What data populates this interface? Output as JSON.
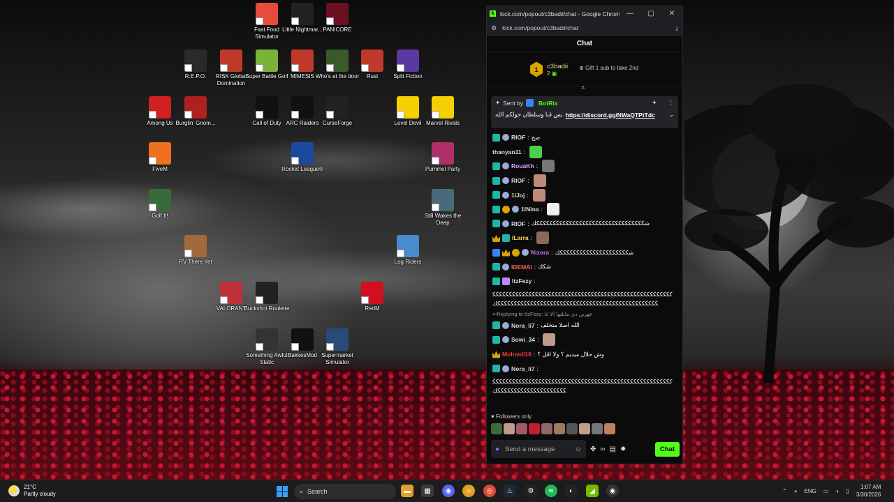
{
  "desktop_icons": [
    {
      "label": "Fast Food Simulator",
      "color": "#e64b3c"
    },
    {
      "label": "Little Nightmar...",
      "color": "#222"
    },
    {
      "label": "PANICORE",
      "color": "#6b1020"
    },
    {
      "label": "R.E.P.O.",
      "color": "#2a2a2a"
    },
    {
      "label": "RISK Global Domination",
      "color": "#c0392b"
    },
    {
      "label": "Super Battle Golf",
      "color": "#7bb33a"
    },
    {
      "label": "MIMESIS",
      "color": "#c0392b"
    },
    {
      "label": "Who's at the door",
      "color": "#3a5a2a"
    },
    {
      "label": "Rust",
      "color": "#c0392b"
    },
    {
      "label": "Split Fiction",
      "color": "#5a3aa0"
    },
    {
      "label": "Among Us",
      "color": "#d21f1f"
    },
    {
      "label": "Burglin' Gnom...",
      "color": "#b02020"
    },
    {
      "label": "Call of Duty",
      "color": "#111"
    },
    {
      "label": "ARC Raiders",
      "color": "#111"
    },
    {
      "label": "CurseForge",
      "color": "#222"
    },
    {
      "label": "Level Devil",
      "color": "#f5d000"
    },
    {
      "label": "Marvel Rivals",
      "color": "#f5d000"
    },
    {
      "label": "FiveM",
      "color": "#f07020"
    },
    {
      "label": "Rocket League®",
      "color": "#1a4aa0"
    },
    {
      "label": "Pummel Party",
      "color": "#b0306a"
    },
    {
      "label": "Golf It!",
      "color": "#3a6a3a"
    },
    {
      "label": "Still Wakes the Deep",
      "color": "#4a6a7a"
    },
    {
      "label": "RV There Yet",
      "color": "#a06a3a"
    },
    {
      "label": "Log Riders",
      "color": "#4a8ad0"
    },
    {
      "label": "VALORANT",
      "color": "#c0303a"
    },
    {
      "label": "Buckshot Roulette",
      "color": "#222"
    },
    {
      "label": "RedM",
      "color": "#d01020"
    },
    {
      "label": "Something Awful Static",
      "color": "#333"
    },
    {
      "label": "BakkesMod",
      "color": "#111"
    },
    {
      "label": "Supermarket Simulator",
      "color": "#2a4a7a"
    }
  ],
  "window": {
    "title": "kick.com/popout/c3badii/chat - Google Chrome",
    "url": "kick.com/popout/c3badii/chat",
    "chat_header": "Chat"
  },
  "pinned": {
    "rank": "1",
    "user": "c3badii",
    "count": "2",
    "gift_text": "Gift 1 sub to take 2nd"
  },
  "bot_message": {
    "sent_by": "Sent by",
    "bot_name": "BotRix",
    "text": "بس قنا وسلطان حولكم الله",
    "link": "https://discord.gg/NWaQTPtTdc"
  },
  "messages": [
    {
      "name": "RIOF",
      "color": "#ddd",
      "text": "صح",
      "badges": [
        "sub",
        "moji"
      ]
    },
    {
      "name": "thanyan11",
      "color": "#ddd",
      "text": "",
      "emote": "#4ad04a",
      "badges": []
    },
    {
      "name": "RouaKh",
      "color": "#d8a0ff",
      "text": "",
      "emote": "#777",
      "badges": [
        "sub",
        "moji"
      ]
    },
    {
      "name": "RIOF",
      "color": "#ddd",
      "text": "",
      "emote": "#c08a7a",
      "badges": [
        "sub",
        "moji"
      ]
    },
    {
      "name": "1iJoj",
      "color": "#ddd",
      "text": "",
      "emote": "#c08a7a",
      "badges": [
        "sub",
        "moji"
      ]
    },
    {
      "name": "1lNina",
      "color": "#ddd",
      "text": "",
      "emote": "#eee",
      "badges": [
        "sub",
        "vip",
        "moji"
      ]
    },
    {
      "name": "RIOF",
      "color": "#ddd",
      "text": "شكككككككككككككككككككككككككككككككككك",
      "badges": [
        "sub",
        "moji"
      ]
    },
    {
      "name": "ILarra",
      "color": "#ffd866",
      "text": "",
      "emote": "#8a6a5a",
      "badges": [
        "crown",
        "sub"
      ]
    },
    {
      "name": "Nizora",
      "color": "#c07aff",
      "text": "شكككككككككككككككككككككك",
      "badges": [
        "mod",
        "crown",
        "vip",
        "moji"
      ]
    },
    {
      "name": "IDEMAI",
      "color": "#ff5a5a",
      "text": "شكك",
      "badges": [
        "sub",
        "moji"
      ]
    },
    {
      "name": "ItzFezy",
      "color": "#ddd",
      "text": "",
      "badges": [
        "sub",
        "gift"
      ]
    }
  ],
  "long_message": "ككككككككككككككككككككككككككككككككككككككككككككككككككككككككككككككككككككككككككككككككككككككككككككككككككككككككك",
  "reply_text": "Replying to ItzFezy: عهرين دي مايلتها الا انا",
  "messages2": [
    {
      "name": "Nora_li7",
      "color": "#ddd",
      "text": "الله اصلا متخلف",
      "badges": [
        "sub",
        "moji"
      ]
    },
    {
      "name": "Sowi_34",
      "color": "#ddd",
      "text": "",
      "emote": "#c09a8a",
      "badges": [
        "sub",
        "moji"
      ]
    },
    {
      "name": "Mohmdl16",
      "color": "#ff3a3a",
      "text": "وش حلال ميديم ؟ ولا اقل ؟",
      "badges": [
        "crown"
      ]
    },
    {
      "name": "Nora_li7",
      "color": "#ddd",
      "text": "",
      "badges": [
        "sub",
        "moji"
      ]
    }
  ],
  "long_message2": "ككككككككككككككككككككككككككككككككككككككككككككككككككككككككككككككككككككككككككككك",
  "followers_only": "Followers only",
  "input_placeholder": "Send a message",
  "send_label": "Chat",
  "taskbar": {
    "temp": "21°C",
    "condition": "Partly cloudy",
    "search": "Search",
    "lang": "ENG",
    "time": "1:07 AM",
    "date": "3/30/2026"
  }
}
